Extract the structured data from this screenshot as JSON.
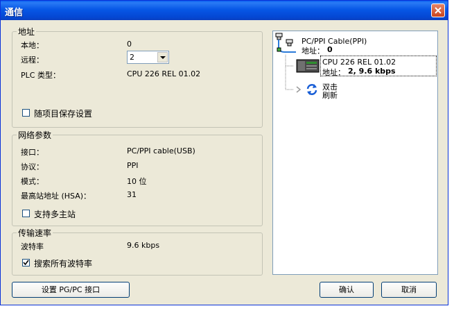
{
  "window": {
    "title": "通信"
  },
  "address": {
    "legend": "地址",
    "local_label": "本地：",
    "local_value": "0",
    "remote_label": "远程：",
    "remote_value": "2",
    "plc_type_label": "PLC 类型：",
    "plc_type_value": "CPU 226 REL 01.02",
    "save_label": "随项目保存设置"
  },
  "network": {
    "legend": "网络参数",
    "interface_label": "接口：",
    "interface_value": "PC/PPI cable(USB)",
    "protocol_label": "协议：",
    "protocol_value": "PPI",
    "mode_label": "模式：",
    "mode_value": "10 位",
    "hsa_label": "最高站地址 (HSA)：",
    "hsa_value": "31",
    "multimaster_label": "支持多主站"
  },
  "rate": {
    "legend": "传输速率",
    "baud_label": "波特率",
    "baud_value": "9.6 kbps",
    "search_label": "搜索所有波特率",
    "search_checked": true
  },
  "tree": {
    "cable_name": "PC/PPI Cable(PPI)",
    "cable_address_prefix": "地址：",
    "cable_address_value": "0",
    "cpu_name": "CPU 226 REL 01.02",
    "cpu_address_prefix": "地址：",
    "cpu_address_value": "2, 9.6 kbps",
    "refresh_line1": "双击",
    "refresh_line2": "刷新"
  },
  "buttons": {
    "setup_pgpc": "设置 PG/PC 接口",
    "ok": "确认",
    "cancel": "取消"
  }
}
